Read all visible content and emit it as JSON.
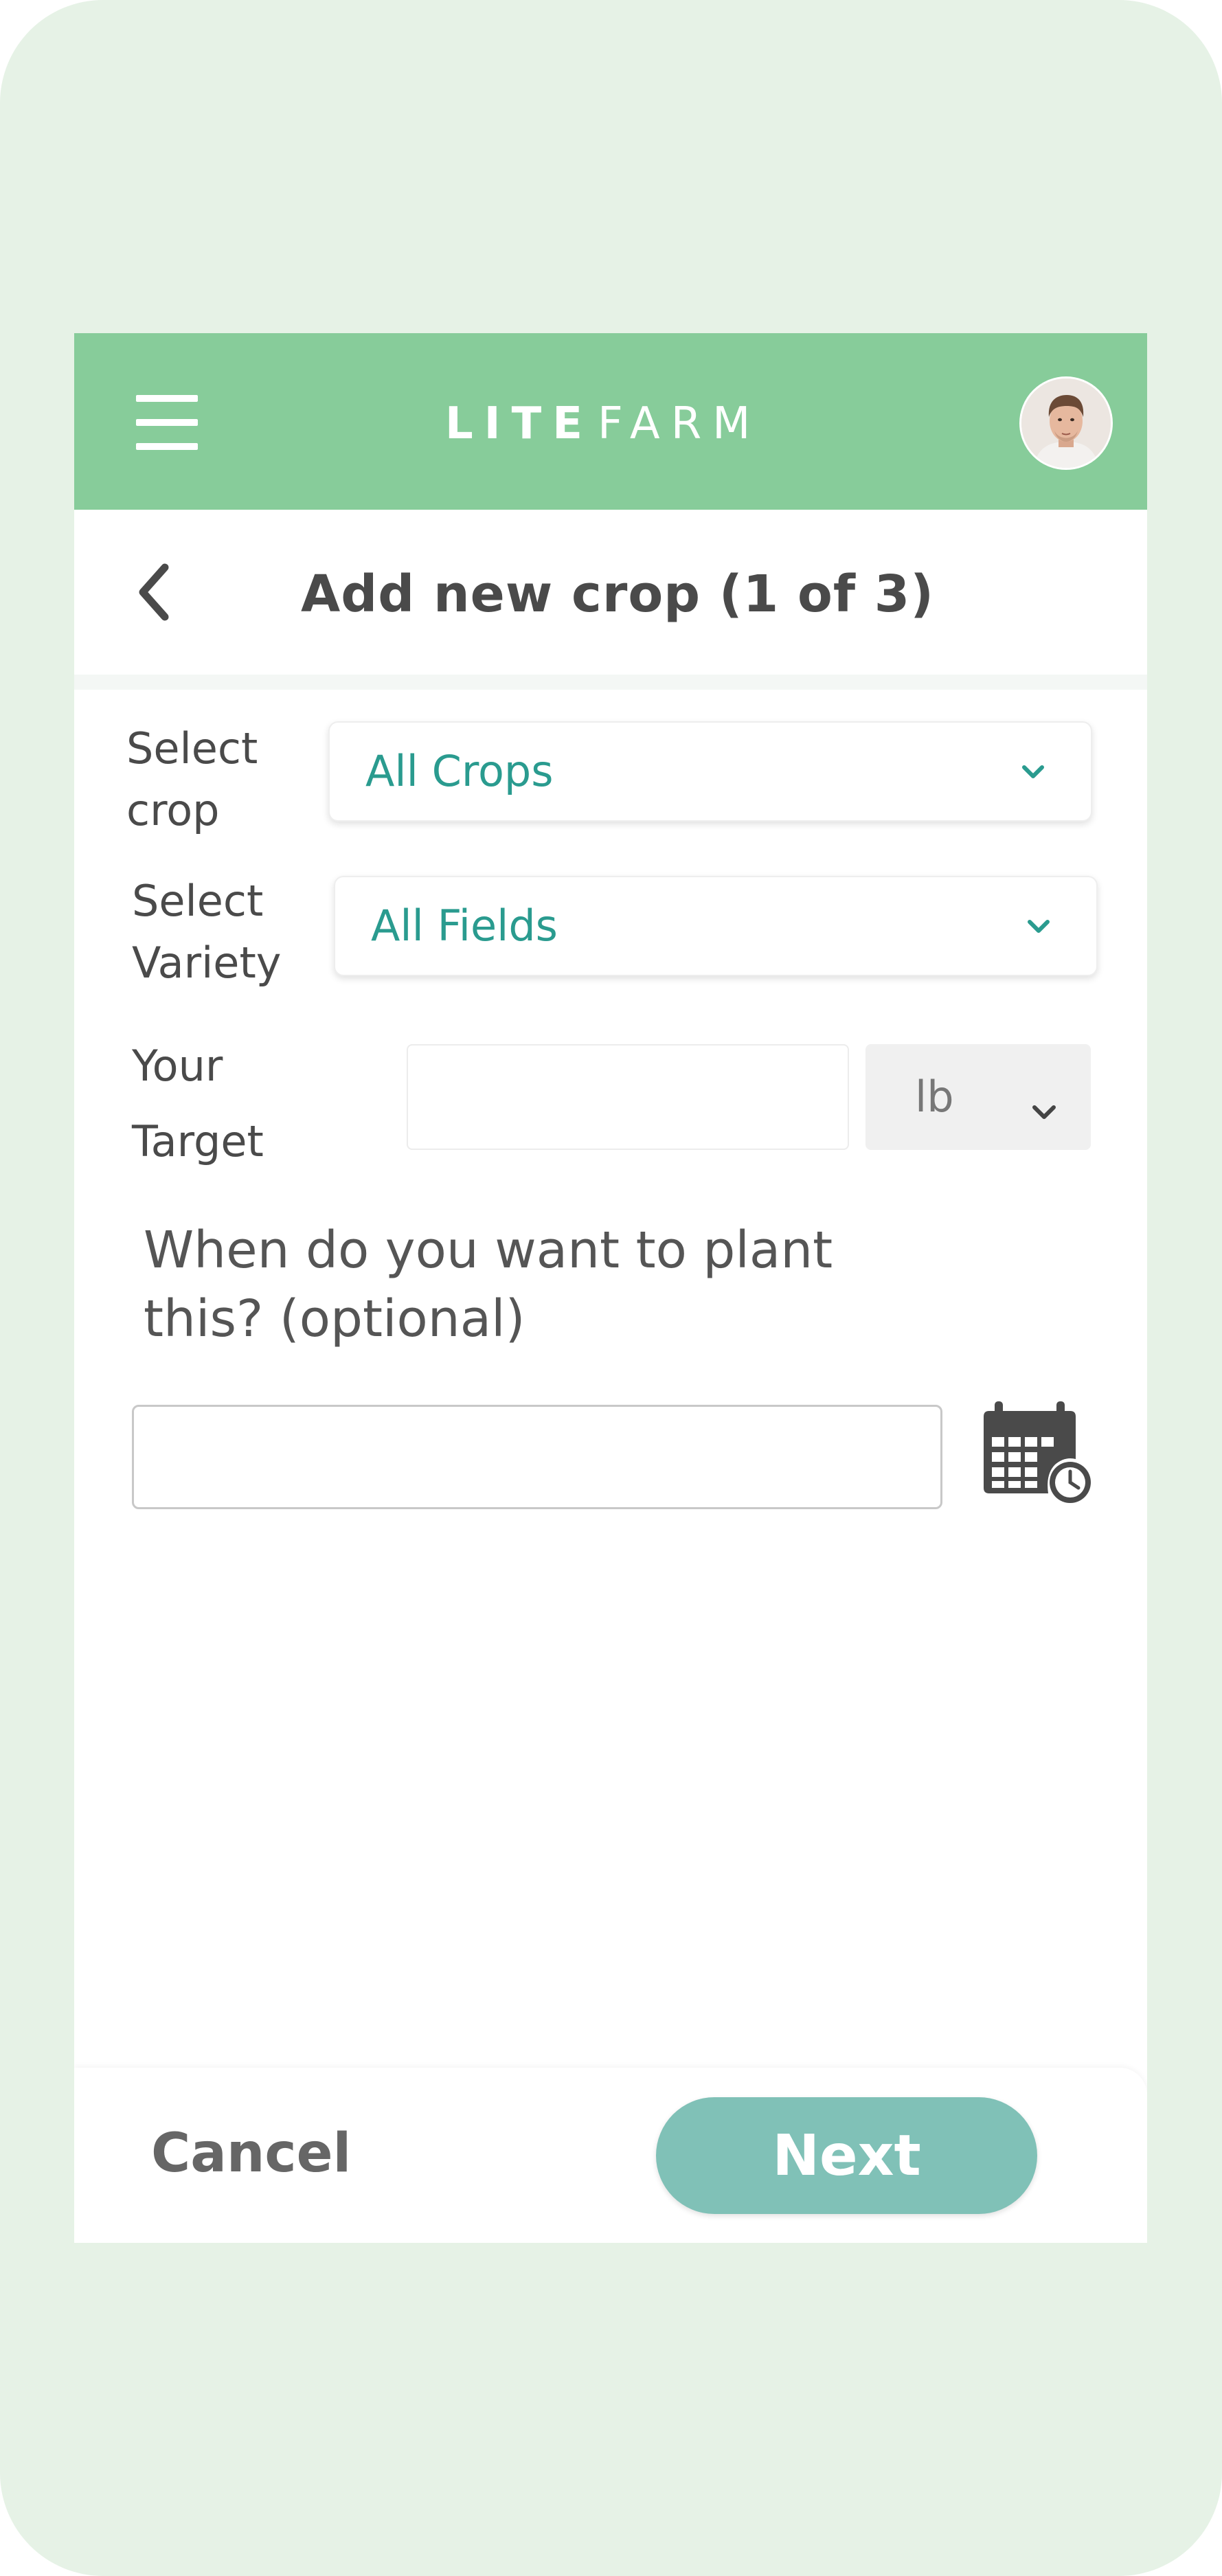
{
  "header": {
    "logo_bold": "LITE",
    "logo_light": "FARM",
    "menu_icon": "hamburger-menu-icon",
    "avatar_icon": "user-avatar",
    "background_color": "#87cc9a"
  },
  "title_bar": {
    "back_icon": "chevron-left-icon",
    "title": "Add new crop (1 of 3)"
  },
  "form": {
    "crop": {
      "label_line1": "Select",
      "label_line2": "crop",
      "selected": "All Crops"
    },
    "variety": {
      "label_line1": "Select",
      "label_line2": "Variety",
      "selected": "All Fields"
    },
    "target": {
      "label_line1": "Your",
      "label_line2": "Target",
      "value": "",
      "unit": "lb"
    },
    "plant_date": {
      "question_line1": "When do you want to plant",
      "question_line2": "this? (optional)",
      "value": "",
      "calendar_icon": "calendar-clock-icon"
    }
  },
  "footer": {
    "cancel_label": "Cancel",
    "next_label": "Next",
    "next_color": "#80c1b7"
  },
  "colors": {
    "accent_text": "#2a9b8f",
    "device_background": "#e6f2e6"
  }
}
